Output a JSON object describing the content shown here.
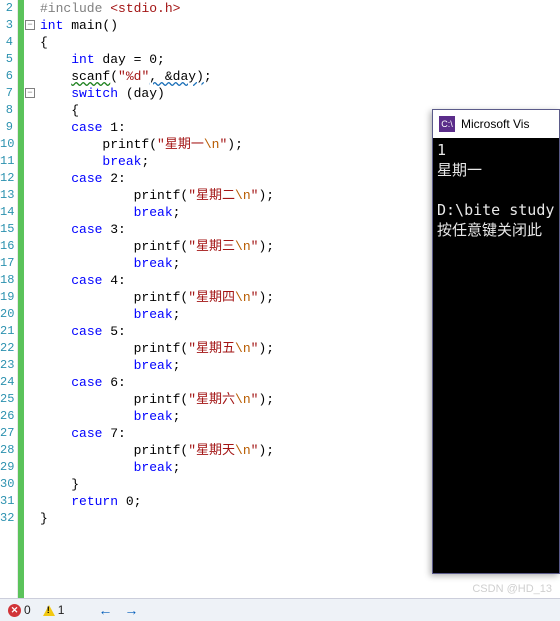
{
  "lineStart": 2,
  "lines": [
    {
      "n": 2,
      "html": "<span class='inc'>#include</span> <span class='hdr'>&lt;stdio.h&gt;</span>"
    },
    {
      "n": 3,
      "fold": "-",
      "html": "<span class='kw'>int</span> main()"
    },
    {
      "n": 4,
      "html": "{"
    },
    {
      "n": 5,
      "html": "    <span class='kw'>int</span> day = 0;"
    },
    {
      "n": 6,
      "html": "    <span class='wavy'>scanf</span>(<span class='str'>\"%d\"</span><span class='wavy-blue'>, &amp;day)</span>;"
    },
    {
      "n": 7,
      "fold": "-",
      "html": "    <span class='kw'>switch</span> (day)"
    },
    {
      "n": 8,
      "html": "    {"
    },
    {
      "n": 9,
      "html": "    <span class='kw'>case</span> 1:"
    },
    {
      "n": 10,
      "html": "        printf(<span class='str'>\"星期一<span class='esc'>\\n</span>\"</span>);"
    },
    {
      "n": 11,
      "html": "        <span class='kw'>break</span>;"
    },
    {
      "n": 12,
      "html": "    <span class='kw'>case</span> 2:"
    },
    {
      "n": 13,
      "html": "            printf(<span class='str'>\"星期二<span class='esc'>\\n</span>\"</span>);"
    },
    {
      "n": 14,
      "html": "            <span class='kw'>break</span>;"
    },
    {
      "n": 15,
      "html": "    <span class='kw'>case</span> 3:"
    },
    {
      "n": 16,
      "html": "            printf(<span class='str'>\"星期三<span class='esc'>\\n</span>\"</span>);"
    },
    {
      "n": 17,
      "html": "            <span class='kw'>break</span>;"
    },
    {
      "n": 18,
      "html": "    <span class='kw'>case</span> 4:"
    },
    {
      "n": 19,
      "html": "            printf(<span class='str'>\"星期四<span class='esc'>\\n</span>\"</span>);"
    },
    {
      "n": 20,
      "html": "            <span class='kw'>break</span>;"
    },
    {
      "n": 21,
      "html": "    <span class='kw'>case</span> 5:"
    },
    {
      "n": 22,
      "html": "            printf(<span class='str'>\"星期五<span class='esc'>\\n</span>\"</span>);"
    },
    {
      "n": 23,
      "html": "            <span class='kw'>break</span>;"
    },
    {
      "n": 24,
      "html": "    <span class='kw'>case</span> 6:"
    },
    {
      "n": 25,
      "html": "            printf(<span class='str'>\"星期六<span class='esc'>\\n</span>\"</span>);"
    },
    {
      "n": 26,
      "html": "            <span class='kw'>break</span>;"
    },
    {
      "n": 27,
      "html": "    <span class='kw'>case</span> 7:"
    },
    {
      "n": 28,
      "html": "            printf(<span class='str'>\"星期天<span class='esc'>\\n</span>\"</span>);"
    },
    {
      "n": 29,
      "hl": true,
      "html": "            <span class='kw'>break</span>;"
    },
    {
      "n": 30,
      "html": "    }"
    },
    {
      "n": 31,
      "html": "    <span class='kw'>return</span> 0;"
    },
    {
      "n": 32,
      "html": "}"
    }
  ],
  "console": {
    "title": "Microsoft Vis",
    "icon": "C:\\",
    "lines": [
      "1",
      "星期一",
      "",
      "D:\\bite study",
      "按任意键关闭此"
    ]
  },
  "status": {
    "errors": 0,
    "warnings": 1
  },
  "watermark": "CSDN @HD_13"
}
